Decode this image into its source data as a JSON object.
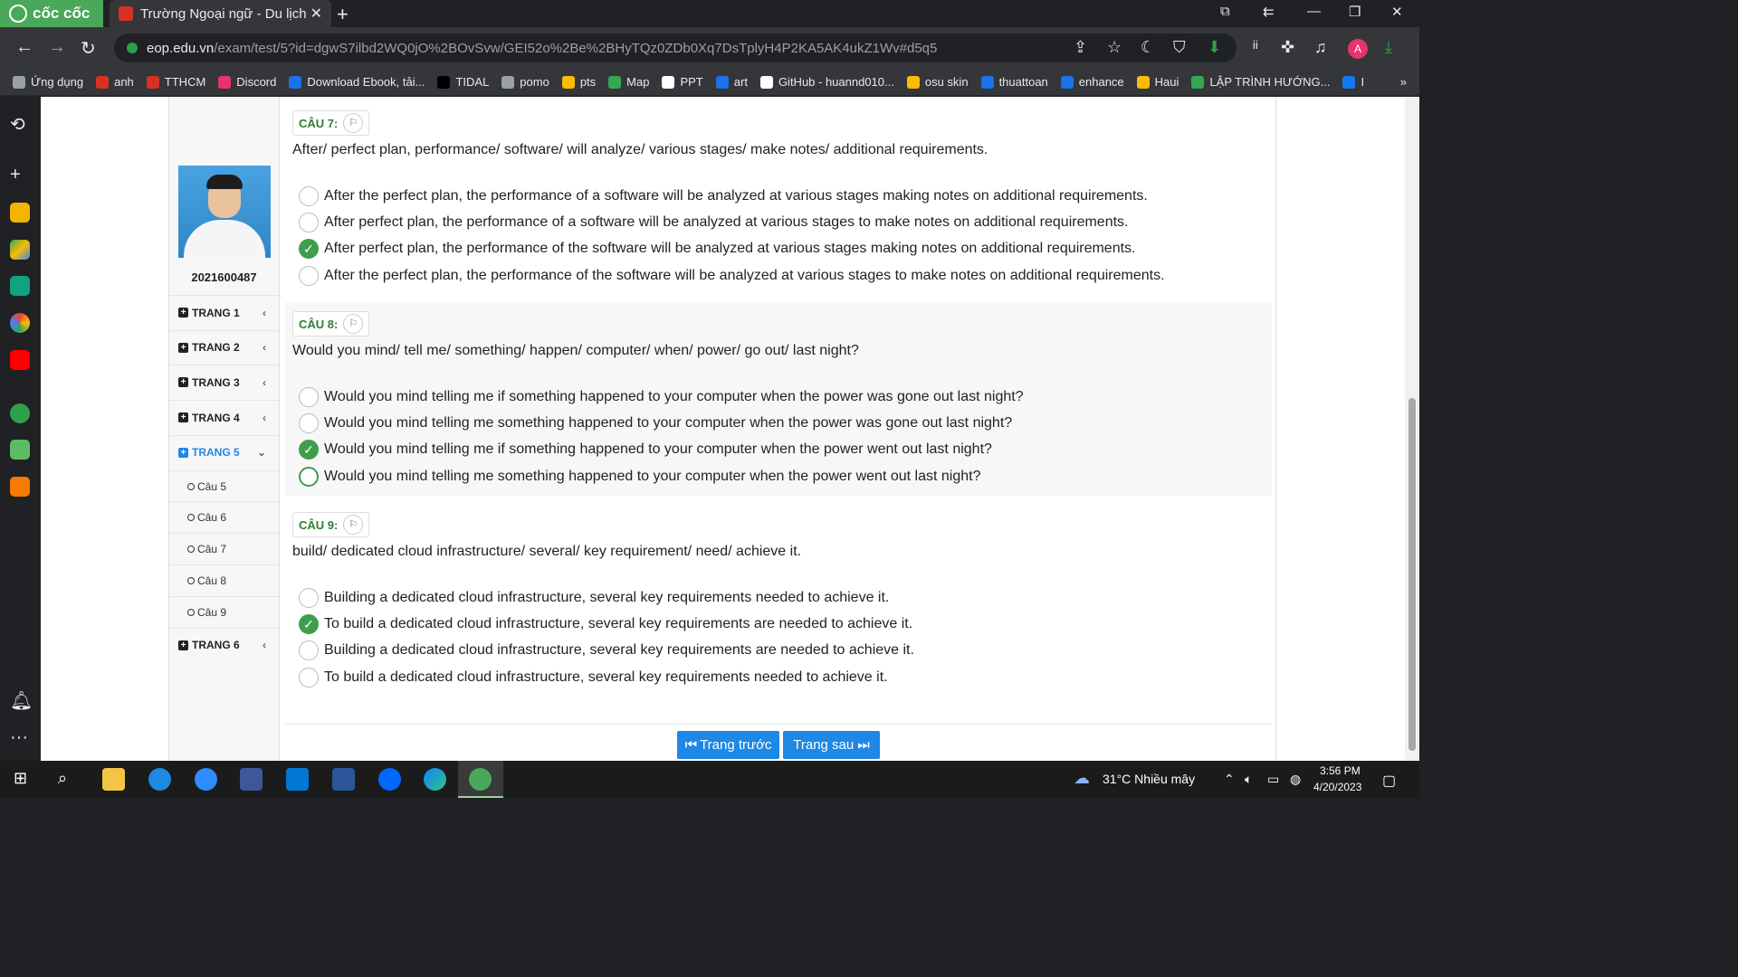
{
  "browser": {
    "brand": "cốc cốc",
    "tab_title": "Trường Ngoại ngữ - Du lịch",
    "url_host": "eop.edu.vn",
    "url_path": "/exam/test/5?id=dgwS7ilbd2WQ0jO%2BOvSvw/GEI52o%2Be%2BHyTQz0ZDb0Xq7DsTplyH4P2KA5AK4ukZ1Wv#d5q5",
    "profile_initial": "A",
    "bookmarks": [
      "Ứng dụng",
      "anh",
      "TTHCM",
      "Discord",
      "Download Ebook, tải...",
      "TIDAL",
      "pomo",
      "pts",
      "Map",
      "PPT",
      "art",
      "GitHub - huannd010...",
      "osu skin",
      "thuattoan",
      "enhance",
      "Haui",
      "LẬP TRÌNH HƯỚNG...",
      "I"
    ],
    "bookmark_colors": [
      "#9aa0a6",
      "#d93025",
      "#d93025",
      "#e8336b",
      "#1a73e8",
      "#000000",
      "#9aa0a6",
      "#fbbc04",
      "#34a853",
      "#ffffff",
      "#1a73e8",
      "#ffffff",
      "#fbbc04",
      "#1a73e8",
      "#1a73e8",
      "#fbbc04",
      "#34a853",
      "#1877f2"
    ]
  },
  "student": {
    "id": "2021600487"
  },
  "pages": [
    {
      "label": "TRANG 1",
      "expanded": false
    },
    {
      "label": "TRANG 2",
      "expanded": false
    },
    {
      "label": "TRANG 3",
      "expanded": false
    },
    {
      "label": "TRANG 4",
      "expanded": false
    },
    {
      "label": "TRANG 5",
      "expanded": true
    },
    {
      "label": "TRANG 6",
      "expanded": false
    }
  ],
  "page5_items": [
    "Câu 5",
    "Câu 6",
    "Câu 7",
    "Câu 8",
    "Câu 9"
  ],
  "questions": [
    {
      "tag": "CÂU 7:",
      "prompt": "After/ perfect plan, performance/ software/ will analyze/ various stages/ make notes/ additional requirements.",
      "options": [
        "After the perfect plan, the performance of a software will be analyzed at various stages making notes on additional requirements.",
        "After perfect plan, the performance of a software will be analyzed at various stages to make notes on additional requirements.",
        "After perfect plan, the performance of the software will be analyzed at various stages making notes on additional requirements.",
        "After the perfect plan, the performance of the software will be analyzed at various stages to make notes on additional requirements."
      ],
      "selected_index": 2
    },
    {
      "tag": "CÂU 8:",
      "prompt": "Would you mind/ tell me/ something/ happen/ computer/ when/ power/ go out/ last night?",
      "options": [
        "Would you mind telling me if something happened to your computer when the power was gone out last night?",
        "Would you mind telling me something happened to your computer when the power was gone out last night?",
        "Would you mind telling me if something happened to your computer when the power went out last night?",
        "Would you mind telling me something happened to your computer when the power went out last night?"
      ],
      "selected_index": 2
    },
    {
      "tag": "CÂU 9:",
      "prompt": "build/ dedicated cloud infrastructure/ several/ key requirement/ need/ achieve it.",
      "options": [
        "Building a dedicated cloud infrastructure, several key requirements needed to achieve it.",
        "To build a dedicated cloud infrastructure, several key requirements are needed to achieve it.",
        "Building a dedicated cloud infrastructure, several key requirements are needed to achieve it.",
        "To build a dedicated cloud infrastructure, several key requirements needed to achieve it."
      ],
      "selected_index": 1
    }
  ],
  "nav": {
    "prev": "Trang trước",
    "next": "Trang sau"
  },
  "taskbar": {
    "weather": "31°C  Nhiều mây",
    "time": "3:56 PM",
    "date": "4/20/2023"
  }
}
